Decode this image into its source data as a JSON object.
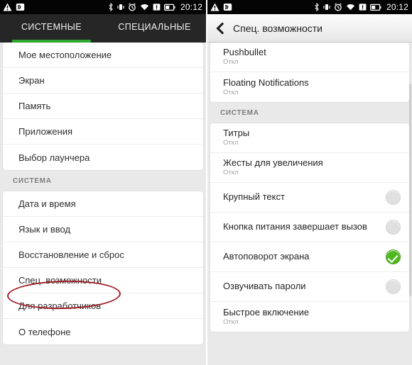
{
  "status_bar": {
    "left_icons": [
      "warning-triangle-icon",
      "missed-call-icon"
    ],
    "right_icons": [
      "bluetooth-icon",
      "vibrate-icon",
      "alarm-icon",
      "wifi-icon",
      "sim-card-icon",
      "battery-icon"
    ],
    "clock": "20:12"
  },
  "left_screen": {
    "tabs": [
      {
        "label": "СИСТЕМНЫЕ",
        "active": true
      },
      {
        "label": "СПЕЦИАЛЬНЫЕ",
        "active": false
      }
    ],
    "accent_color": "#2fa82f",
    "group_one": [
      {
        "label": "Мое местоположение"
      },
      {
        "label": "Экран"
      },
      {
        "label": "Память"
      },
      {
        "label": "Приложения"
      },
      {
        "label": "Выбор лаунчера"
      }
    ],
    "section_header": "СИСТЕМА",
    "group_two": [
      {
        "label": "Дата и время",
        "highlighted": false
      },
      {
        "label": "Язык и ввод",
        "highlighted": false
      },
      {
        "label": "Восстановление и сброс",
        "highlighted": false
      },
      {
        "label": "Спец. возможности",
        "highlighted": true
      },
      {
        "label": "Для разработчиков",
        "highlighted": false
      },
      {
        "label": "О телефоне",
        "highlighted": false
      }
    ]
  },
  "right_screen": {
    "header": {
      "back_icon": "chevron-left-icon",
      "title": "Спец. возможности"
    },
    "group_one": [
      {
        "title": "Pushbullet",
        "sub": "Откл",
        "toggle": null
      },
      {
        "title": "Floating Notifications",
        "sub": "Откл",
        "toggle": null
      }
    ],
    "section_header": "СИСТЕМА",
    "group_two": [
      {
        "title": "Титры",
        "sub": "Откл",
        "toggle": null,
        "highlighted": false
      },
      {
        "title": "Жесты для увеличения",
        "sub": "Откл",
        "toggle": null,
        "highlighted": true
      },
      {
        "title": "Крупный текст",
        "sub": "",
        "toggle": "off",
        "highlighted": false
      },
      {
        "title": "Кнопка питания завершает вызов",
        "sub": "",
        "toggle": "off",
        "highlighted": false
      },
      {
        "title": "Автоповорот экрана",
        "sub": "",
        "toggle": "on",
        "highlighted": false
      },
      {
        "title": "Озвучивать пароли",
        "sub": "",
        "toggle": "off",
        "highlighted": false
      },
      {
        "title": "Быстрое включение",
        "sub": "Откл",
        "toggle": null,
        "highlighted": false
      }
    ],
    "toggle_on_color": "#4fb81f"
  },
  "annotations": {
    "color": "#9e1f26",
    "ellipse_left_target": "Спец. возможности",
    "ellipse_right_target": "Жесты для увеличения"
  }
}
